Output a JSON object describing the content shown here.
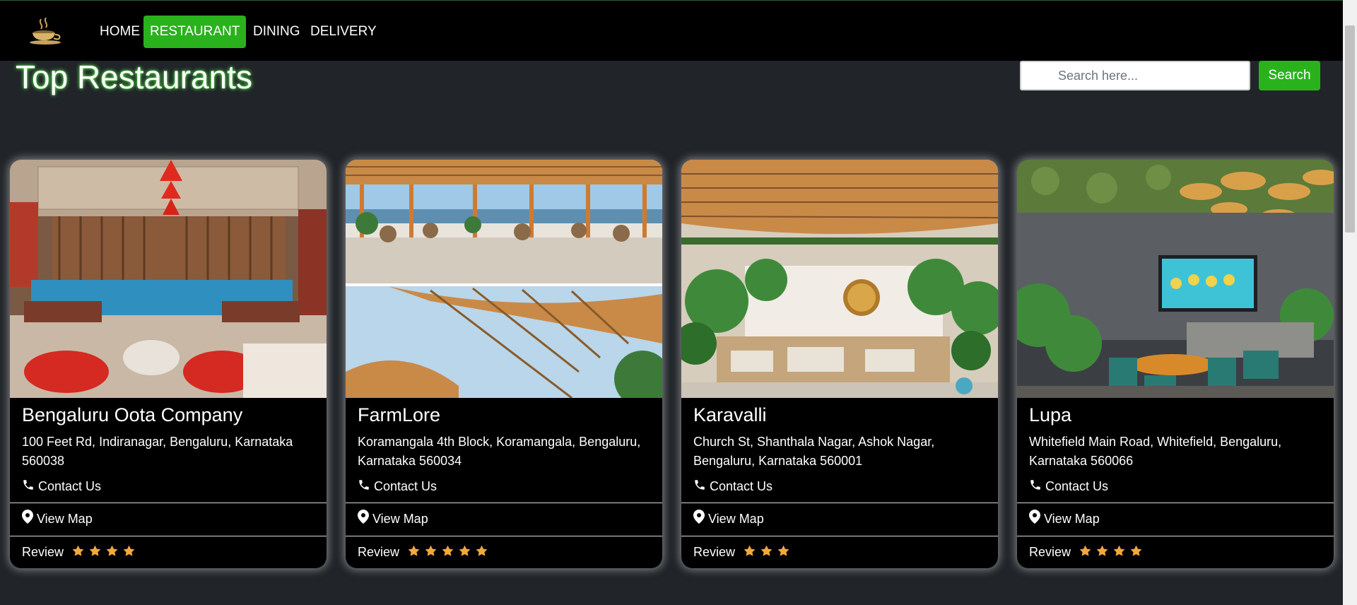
{
  "nav": {
    "logo_icon": "coffee-cup-logo-icon",
    "links": [
      "HOME",
      "RESTAURANT",
      "DINING",
      "DELIVERY"
    ],
    "active": "RESTAURANT",
    "accent_color": "#2ab21d"
  },
  "page": {
    "title": "Top Restaurants"
  },
  "search": {
    "placeholder": "Search here...",
    "button_label": "Search"
  },
  "restaurants": [
    {
      "name": "Bengaluru Oota Company",
      "address": "100 Feet Rd, Indiranagar, Bengaluru, Karnataka 560038",
      "contact_label": "Contact Us",
      "map_label": "View Map",
      "review_label": "Review",
      "stars": 4,
      "image_icon": "restaurant-interior-red-blue-photo"
    },
    {
      "name": "FarmLore",
      "address": "Koramangala 4th Block, Koramangala, Bengaluru, Karnataka 560034",
      "contact_label": "Contact Us",
      "map_label": "View Map",
      "review_label": "Review",
      "stars": 5,
      "image_icon": "terrace-bamboo-roof-photo"
    },
    {
      "name": "Karavalli",
      "address": "Church St, Shanthala Nagar, Ashok Nagar, Bengaluru, Karnataka 560001",
      "contact_label": "Contact Us",
      "map_label": "View Map",
      "review_label": "Review",
      "stars": 3,
      "image_icon": "garden-lounge-photo"
    },
    {
      "name": "Lupa",
      "address": "Whitefield Main Road, Whitefield, Bengaluru, Karnataka 560066",
      "contact_label": "Contact Us",
      "map_label": "View Map",
      "review_label": "Review",
      "stars": 4,
      "image_icon": "rooftop-dining-screen-photo"
    }
  ]
}
